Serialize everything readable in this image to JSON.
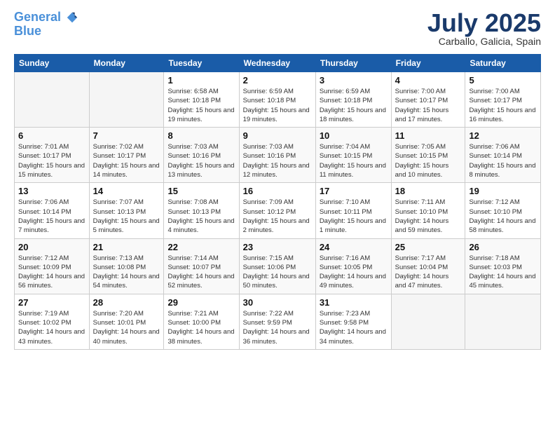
{
  "header": {
    "logo_line1": "General",
    "logo_line2": "Blue",
    "title": "July 2025",
    "subtitle": "Carballo, Galicia, Spain"
  },
  "days_of_week": [
    "Sunday",
    "Monday",
    "Tuesday",
    "Wednesday",
    "Thursday",
    "Friday",
    "Saturday"
  ],
  "weeks": [
    [
      {
        "day": "",
        "info": ""
      },
      {
        "day": "",
        "info": ""
      },
      {
        "day": "1",
        "info": "Sunrise: 6:58 AM\nSunset: 10:18 PM\nDaylight: 15 hours\nand 19 minutes."
      },
      {
        "day": "2",
        "info": "Sunrise: 6:59 AM\nSunset: 10:18 PM\nDaylight: 15 hours\nand 19 minutes."
      },
      {
        "day": "3",
        "info": "Sunrise: 6:59 AM\nSunset: 10:18 PM\nDaylight: 15 hours\nand 18 minutes."
      },
      {
        "day": "4",
        "info": "Sunrise: 7:00 AM\nSunset: 10:17 PM\nDaylight: 15 hours\nand 17 minutes."
      },
      {
        "day": "5",
        "info": "Sunrise: 7:00 AM\nSunset: 10:17 PM\nDaylight: 15 hours\nand 16 minutes."
      }
    ],
    [
      {
        "day": "6",
        "info": "Sunrise: 7:01 AM\nSunset: 10:17 PM\nDaylight: 15 hours\nand 15 minutes."
      },
      {
        "day": "7",
        "info": "Sunrise: 7:02 AM\nSunset: 10:17 PM\nDaylight: 15 hours\nand 14 minutes."
      },
      {
        "day": "8",
        "info": "Sunrise: 7:03 AM\nSunset: 10:16 PM\nDaylight: 15 hours\nand 13 minutes."
      },
      {
        "day": "9",
        "info": "Sunrise: 7:03 AM\nSunset: 10:16 PM\nDaylight: 15 hours\nand 12 minutes."
      },
      {
        "day": "10",
        "info": "Sunrise: 7:04 AM\nSunset: 10:15 PM\nDaylight: 15 hours\nand 11 minutes."
      },
      {
        "day": "11",
        "info": "Sunrise: 7:05 AM\nSunset: 10:15 PM\nDaylight: 15 hours\nand 10 minutes."
      },
      {
        "day": "12",
        "info": "Sunrise: 7:06 AM\nSunset: 10:14 PM\nDaylight: 15 hours\nand 8 minutes."
      }
    ],
    [
      {
        "day": "13",
        "info": "Sunrise: 7:06 AM\nSunset: 10:14 PM\nDaylight: 15 hours\nand 7 minutes."
      },
      {
        "day": "14",
        "info": "Sunrise: 7:07 AM\nSunset: 10:13 PM\nDaylight: 15 hours\nand 5 minutes."
      },
      {
        "day": "15",
        "info": "Sunrise: 7:08 AM\nSunset: 10:13 PM\nDaylight: 15 hours\nand 4 minutes."
      },
      {
        "day": "16",
        "info": "Sunrise: 7:09 AM\nSunset: 10:12 PM\nDaylight: 15 hours\nand 2 minutes."
      },
      {
        "day": "17",
        "info": "Sunrise: 7:10 AM\nSunset: 10:11 PM\nDaylight: 15 hours\nand 1 minute."
      },
      {
        "day": "18",
        "info": "Sunrise: 7:11 AM\nSunset: 10:10 PM\nDaylight: 14 hours\nand 59 minutes."
      },
      {
        "day": "19",
        "info": "Sunrise: 7:12 AM\nSunset: 10:10 PM\nDaylight: 14 hours\nand 58 minutes."
      }
    ],
    [
      {
        "day": "20",
        "info": "Sunrise: 7:12 AM\nSunset: 10:09 PM\nDaylight: 14 hours\nand 56 minutes."
      },
      {
        "day": "21",
        "info": "Sunrise: 7:13 AM\nSunset: 10:08 PM\nDaylight: 14 hours\nand 54 minutes."
      },
      {
        "day": "22",
        "info": "Sunrise: 7:14 AM\nSunset: 10:07 PM\nDaylight: 14 hours\nand 52 minutes."
      },
      {
        "day": "23",
        "info": "Sunrise: 7:15 AM\nSunset: 10:06 PM\nDaylight: 14 hours\nand 50 minutes."
      },
      {
        "day": "24",
        "info": "Sunrise: 7:16 AM\nSunset: 10:05 PM\nDaylight: 14 hours\nand 49 minutes."
      },
      {
        "day": "25",
        "info": "Sunrise: 7:17 AM\nSunset: 10:04 PM\nDaylight: 14 hours\nand 47 minutes."
      },
      {
        "day": "26",
        "info": "Sunrise: 7:18 AM\nSunset: 10:03 PM\nDaylight: 14 hours\nand 45 minutes."
      }
    ],
    [
      {
        "day": "27",
        "info": "Sunrise: 7:19 AM\nSunset: 10:02 PM\nDaylight: 14 hours\nand 43 minutes."
      },
      {
        "day": "28",
        "info": "Sunrise: 7:20 AM\nSunset: 10:01 PM\nDaylight: 14 hours\nand 40 minutes."
      },
      {
        "day": "29",
        "info": "Sunrise: 7:21 AM\nSunset: 10:00 PM\nDaylight: 14 hours\nand 38 minutes."
      },
      {
        "day": "30",
        "info": "Sunrise: 7:22 AM\nSunset: 9:59 PM\nDaylight: 14 hours\nand 36 minutes."
      },
      {
        "day": "31",
        "info": "Sunrise: 7:23 AM\nSunset: 9:58 PM\nDaylight: 14 hours\nand 34 minutes."
      },
      {
        "day": "",
        "info": ""
      },
      {
        "day": "",
        "info": ""
      }
    ]
  ]
}
